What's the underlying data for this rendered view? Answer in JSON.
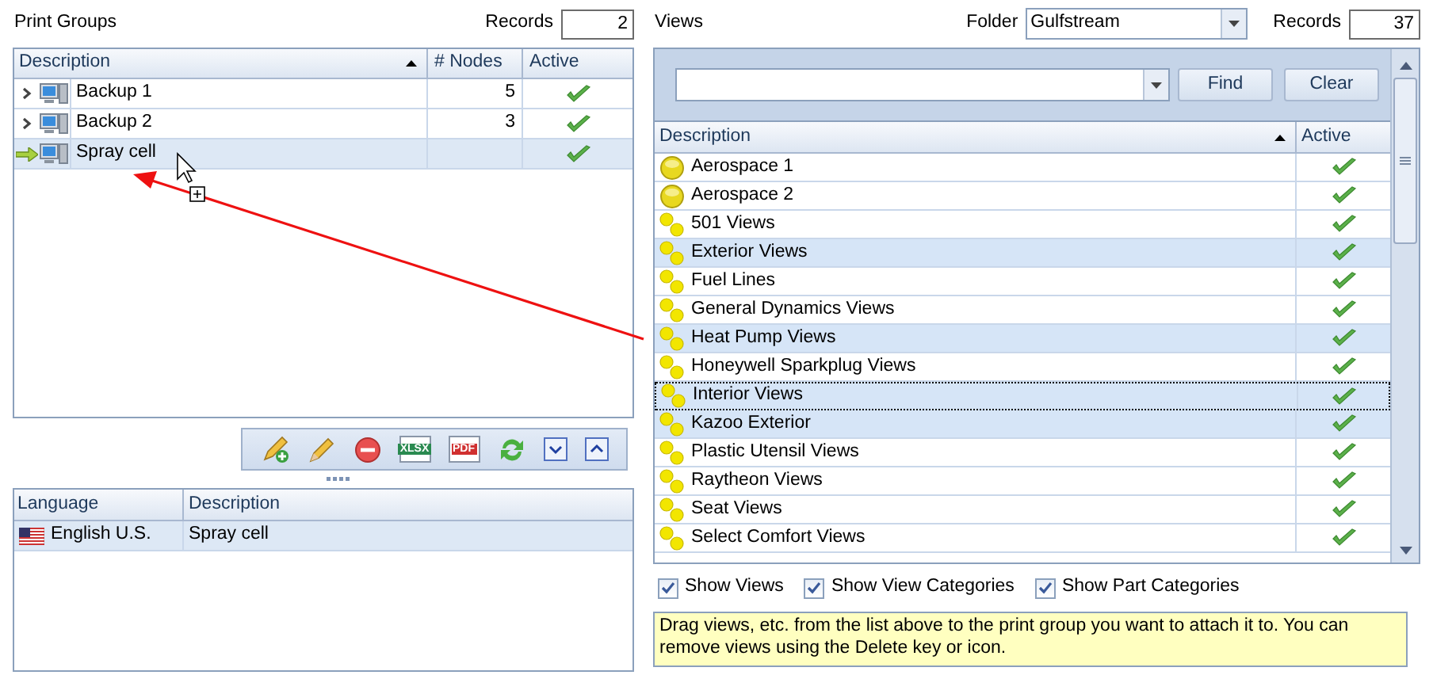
{
  "print_groups": {
    "title": "Print Groups",
    "records_label": "Records",
    "records": "2",
    "columns": [
      "Description",
      "# Nodes",
      "Active"
    ],
    "rows": [
      {
        "description": "Backup 1",
        "nodes": "5",
        "active": true,
        "selected": false
      },
      {
        "description": "Backup 2",
        "nodes": "3",
        "active": true,
        "selected": false
      },
      {
        "description": "Spray cell",
        "nodes": "",
        "active": true,
        "selected": true
      }
    ]
  },
  "toolbar": [
    {
      "kind": "add"
    },
    {
      "kind": "edit"
    },
    {
      "kind": "delete"
    },
    {
      "kind": "xlsx",
      "label": "XLSX"
    },
    {
      "kind": "pdf",
      "label": "PDF"
    },
    {
      "kind": "refresh"
    },
    {
      "kind": "down"
    },
    {
      "kind": "up"
    }
  ],
  "translations": {
    "columns": [
      "Language",
      "Description"
    ],
    "rows": [
      {
        "language": "English U.S.",
        "description": "Spray cell",
        "selected": true
      }
    ]
  },
  "views": {
    "title": "Views",
    "folder_label": "Folder",
    "folder": "Gulfstream",
    "records_label": "Records",
    "records": "37",
    "find": "Find",
    "clear": "Clear",
    "columns": [
      "Description",
      "Active"
    ],
    "rows": [
      {
        "kind": "view",
        "description": "Aerospace 1",
        "active": true,
        "selected": false,
        "focused": false
      },
      {
        "kind": "view",
        "description": "Aerospace 2",
        "active": true,
        "selected": false,
        "focused": false
      },
      {
        "kind": "category",
        "description": "501 Views",
        "active": true,
        "selected": false,
        "focused": false
      },
      {
        "kind": "category",
        "description": "Exterior Views",
        "active": true,
        "selected": true,
        "focused": false
      },
      {
        "kind": "category",
        "description": "Fuel Lines",
        "active": true,
        "selected": false,
        "focused": false
      },
      {
        "kind": "category",
        "description": "General Dynamics Views",
        "active": true,
        "selected": false,
        "focused": false
      },
      {
        "kind": "category",
        "description": "Heat Pump Views",
        "active": true,
        "selected": true,
        "focused": false
      },
      {
        "kind": "category",
        "description": "Honeywell Sparkplug Views",
        "active": true,
        "selected": false,
        "focused": false
      },
      {
        "kind": "category",
        "description": "Interior Views",
        "active": true,
        "selected": true,
        "focused": true
      },
      {
        "kind": "category",
        "description": "Kazoo Exterior",
        "active": true,
        "selected": true,
        "focused": false
      },
      {
        "kind": "category",
        "description": "Plastic Utensil Views",
        "active": true,
        "selected": false,
        "focused": false
      },
      {
        "kind": "category",
        "description": "Raytheon Views",
        "active": true,
        "selected": false,
        "focused": false
      },
      {
        "kind": "category",
        "description": "Seat Views",
        "active": true,
        "selected": false,
        "focused": false
      },
      {
        "kind": "category",
        "description": "Select Comfort Views",
        "active": true,
        "selected": false,
        "focused": false
      }
    ],
    "options": [
      {
        "label": "Show Views",
        "checked": true
      },
      {
        "label": "Show View Categories",
        "checked": true
      },
      {
        "label": "Show Part Categories",
        "checked": true
      }
    ],
    "hint": "Drag views, etc. from the list above to the print group you want to attach it to. You can remove views using the Delete key or icon."
  }
}
